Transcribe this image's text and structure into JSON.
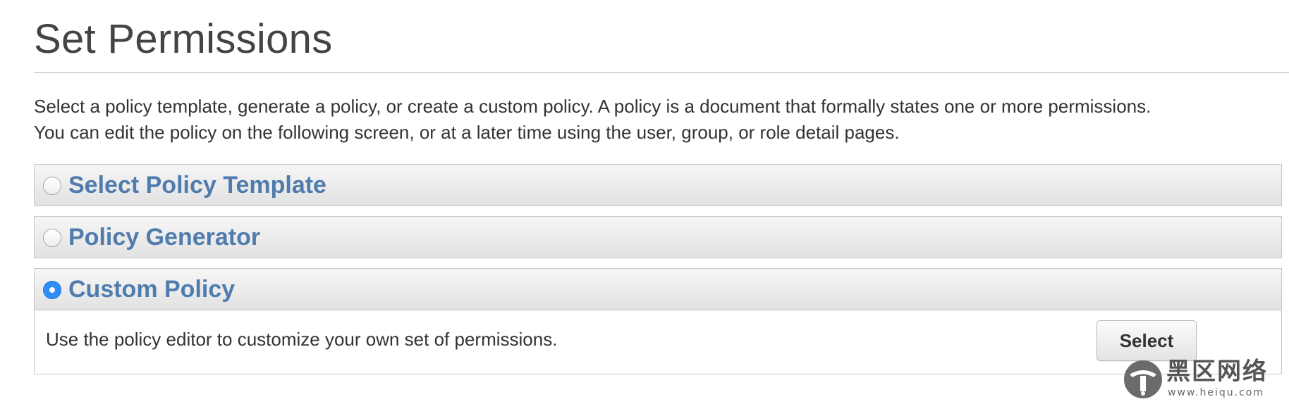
{
  "page": {
    "title": "Set Permissions",
    "intro_line_1": "Select a policy template, generate a policy, or create a custom policy. A policy is a document that formally states one or more permissions.",
    "intro_line_2": "You can edit the policy on the following screen, or at a later time using the user, group, or role detail pages."
  },
  "options": [
    {
      "label": "Select Policy Template",
      "selected": false
    },
    {
      "label": "Policy Generator",
      "selected": false
    },
    {
      "label": "Custom Policy",
      "selected": true,
      "description": "Use the policy editor to customize your own set of permissions.",
      "button_label": "Select"
    }
  ],
  "colors": {
    "option_label": "#4f7cad",
    "radio_selected": "#2f8df5",
    "header_gradient_top": "#f6f6f6",
    "header_gradient_bottom": "#e2e2e2",
    "border": "#c9c9c9"
  },
  "watermark": {
    "title": "黑区网络",
    "url": "www.heiqu.com",
    "icon": "heiqu-logo-icon"
  }
}
